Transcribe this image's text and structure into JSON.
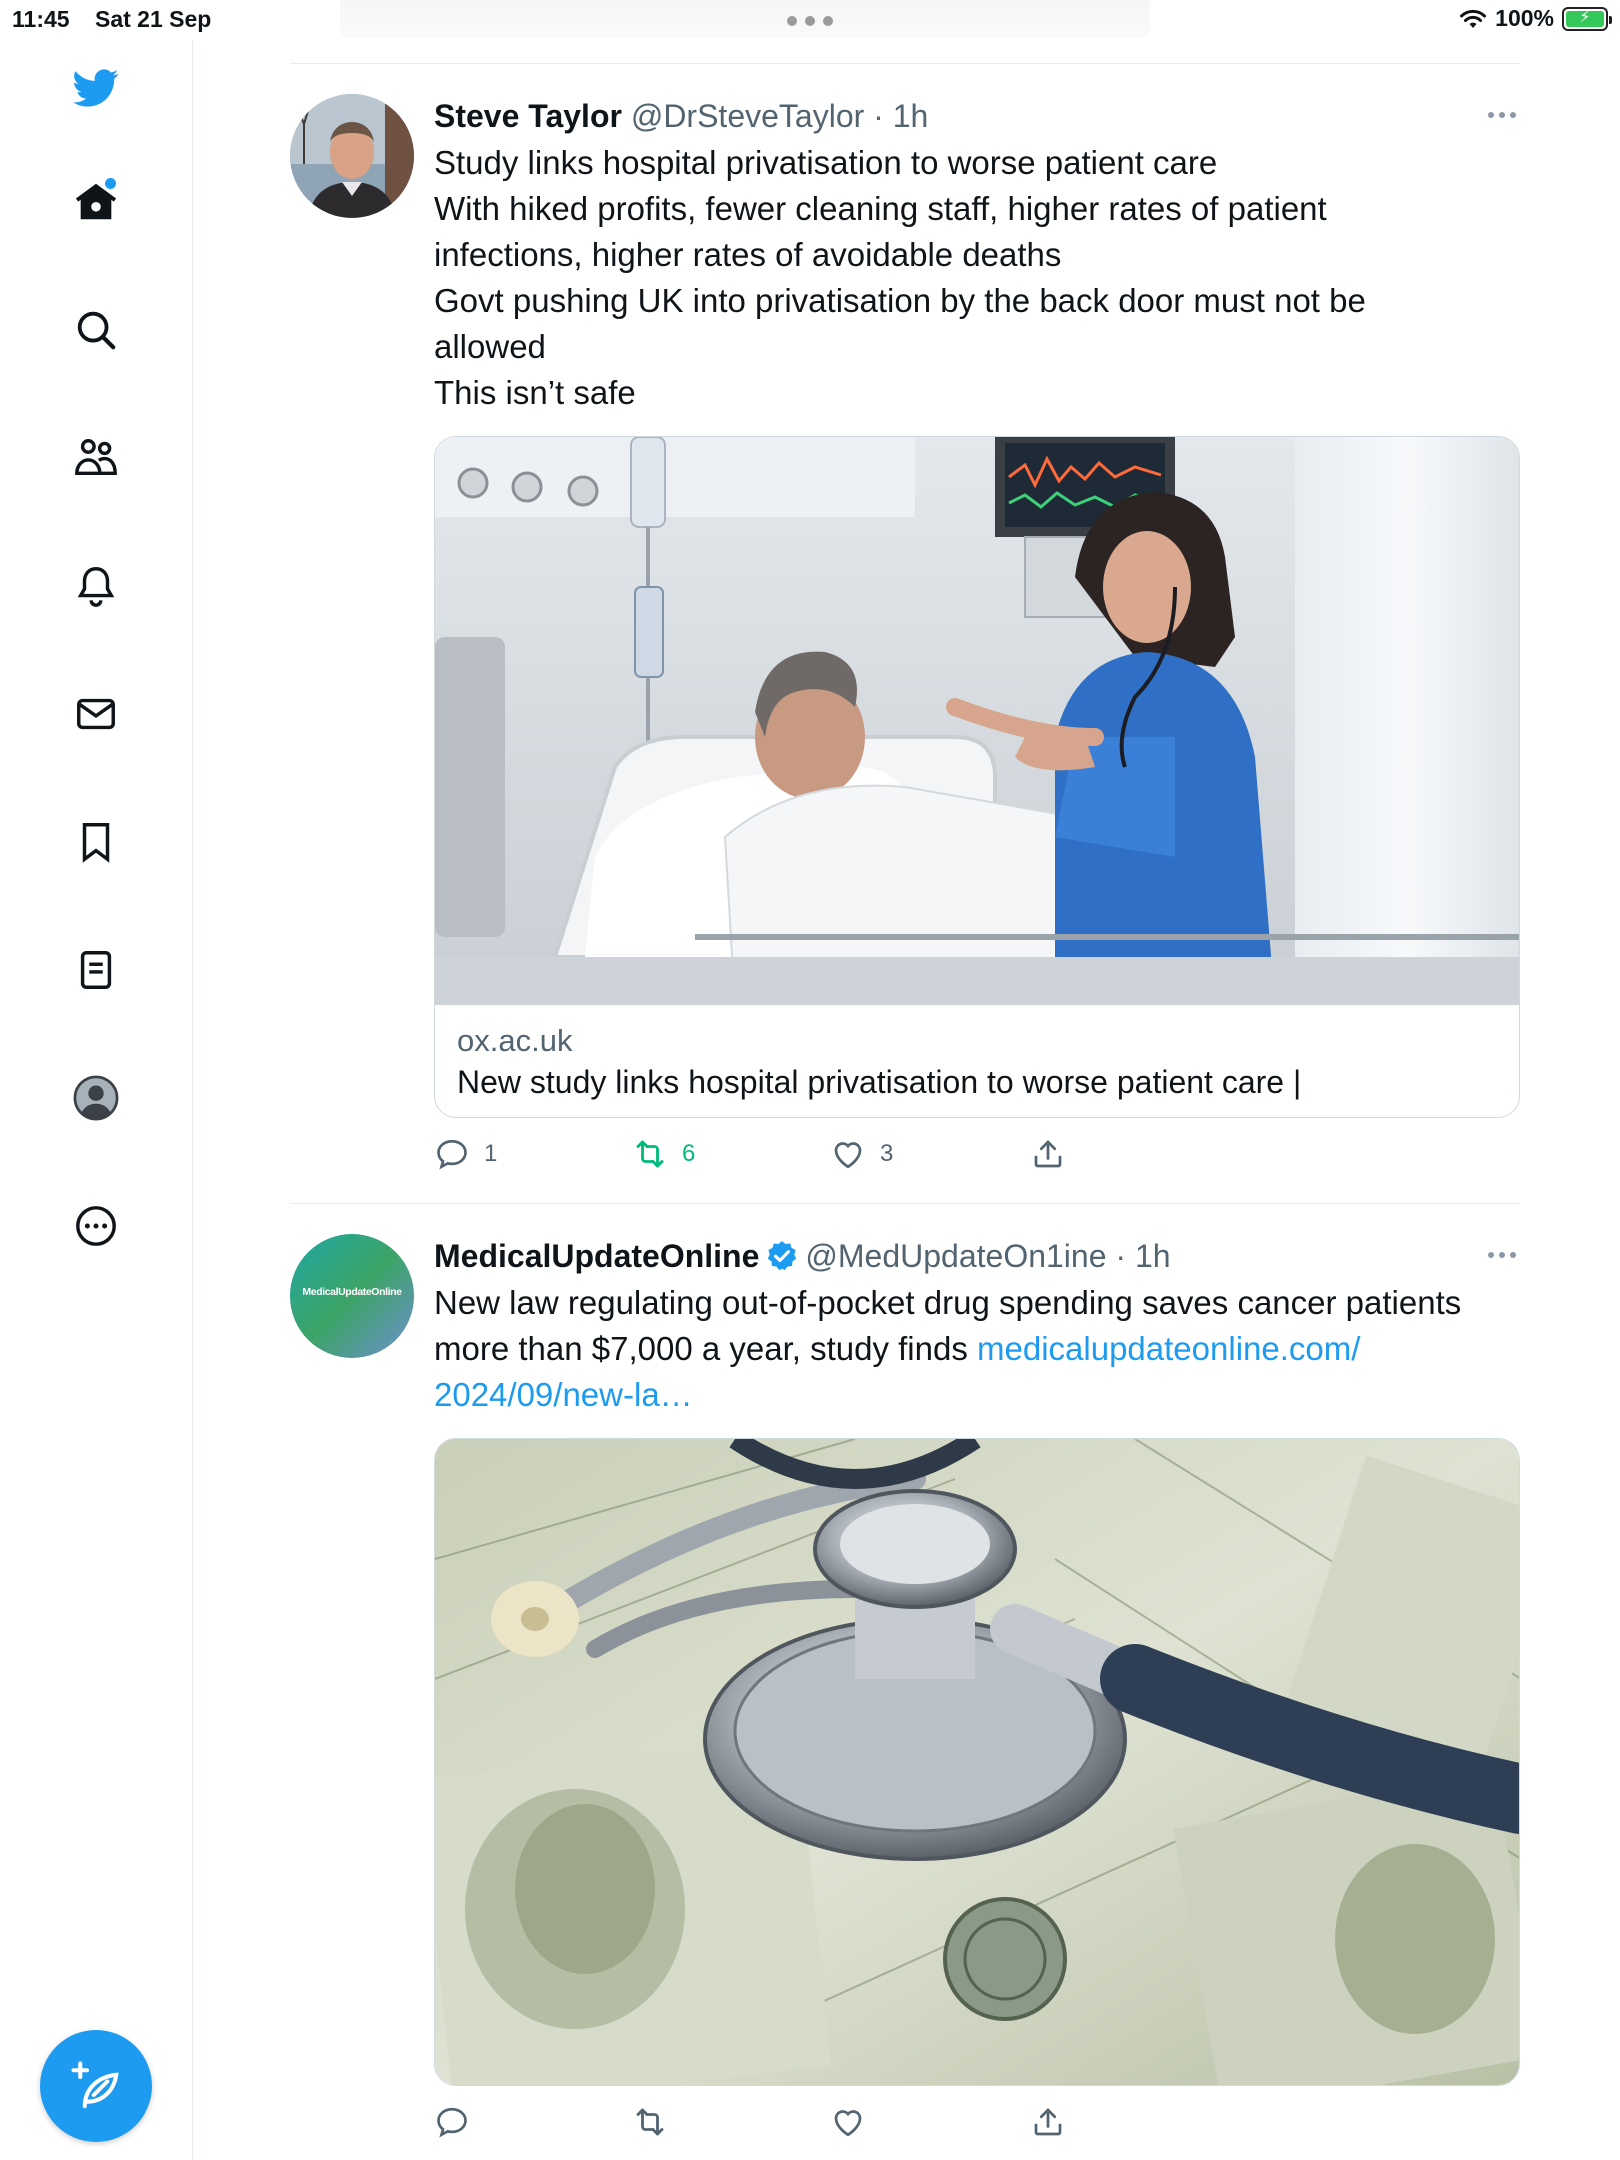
{
  "status_bar": {
    "time": "11:45",
    "date": "Sat 21 Sep",
    "battery": "100%"
  },
  "sidebar": {
    "items": [
      {
        "icon": "twitter-bird-icon",
        "color": "#1d9bf0"
      },
      {
        "icon": "home-icon",
        "has_notification_dot": true
      },
      {
        "icon": "search-icon"
      },
      {
        "icon": "communities-icon"
      },
      {
        "icon": "bell-icon"
      },
      {
        "icon": "mail-icon"
      },
      {
        "icon": "bookmark-icon"
      },
      {
        "icon": "lists-icon"
      },
      {
        "icon": "profile-avatar-icon"
      },
      {
        "icon": "more-circle-icon"
      }
    ],
    "compose_icon": "compose-tweet-icon"
  },
  "tweets": [
    {
      "name": "Steve Taylor",
      "handle": "@DrSteveTaylor",
      "separator": "·",
      "time": "1h",
      "text_lines": [
        "Study links hospital privatisation to worse patient care",
        "With hiked profits, fewer cleaning staff, higher rates of patient",
        "infections, higher rates of avoidable deaths",
        "Govt pushing UK into privatisation by the back door must not be",
        "allowed",
        "This isn’t safe"
      ],
      "card": {
        "domain": "ox.ac.uk",
        "title": "New study links hospital privatisation to worse patient care |"
      },
      "actions": {
        "replies": "1",
        "retweets": "6",
        "likes": "3"
      }
    },
    {
      "name": "MedicalUpdateOnline",
      "verified": true,
      "handle": "@MedUpdateOn1ine",
      "separator": "·",
      "time": "1h",
      "avatar_text": "MedicalUpdateOnline",
      "text_line1": "New law regulating out-of-pocket drug spending saves cancer patients",
      "text_line2_plain": "more than $7,000 a year, study finds ",
      "text_line2_link": "medicalupdateonline.com/",
      "text_line3_link": "2024/09/new-la…",
      "actions": {
        "replies": "",
        "retweets": "",
        "likes": ""
      }
    }
  ],
  "colors": {
    "accent": "#1d9bf0",
    "retweet_green": "#00ba7c",
    "secondary_text": "#536471"
  }
}
